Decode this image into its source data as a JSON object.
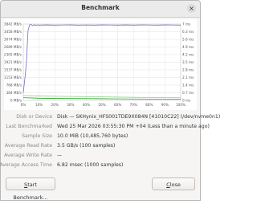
{
  "window": {
    "title": "Benchmark"
  },
  "chart_data": {
    "type": "line",
    "y_left_ticks": [
      "3842 MB/s",
      "3458 MB/s",
      "3074 MB/s",
      "2689 MB/s",
      "2305 MB/s",
      "1921 MB/s",
      "1537 MB/s",
      "1153 MB/s",
      "768 MB/s",
      "384 MB/s",
      "0 MB/s"
    ],
    "y_right_ticks": [
      "7 ms",
      "6.3 ms",
      "5.6 ms",
      "4.9 ms",
      "4.2 ms",
      "3.5 ms",
      "2.8 ms",
      "2.1 ms",
      "1.4 ms",
      "0.7 ms",
      "0 ms"
    ],
    "x_ticks": [
      "0%",
      "10%",
      "20%",
      "30%",
      "40%",
      "50%",
      "60%",
      "70%",
      "80%",
      "90%",
      "100%"
    ],
    "xlim": [
      0,
      100
    ],
    "ylim_left": [
      0,
      3842
    ],
    "ylim_right": [
      0,
      7
    ],
    "grid": true,
    "series": [
      {
        "color": "#7070c8",
        "axis": "left",
        "x": [
          0,
          1,
          2,
          3,
          4,
          5,
          6,
          7,
          8,
          9,
          10,
          15,
          20,
          25,
          30,
          35,
          40,
          45,
          50,
          55,
          60,
          65,
          70,
          75,
          80,
          85,
          90,
          95,
          100
        ],
        "values": [
          384,
          1100,
          1900,
          3500,
          3800,
          3820,
          3760,
          3810,
          3780,
          3800,
          3790,
          3800,
          3790,
          3795,
          3800,
          3790,
          3795,
          3790,
          3800,
          3795,
          3790,
          3800,
          3790,
          3800,
          3795,
          3790,
          3800,
          3795,
          3790
        ]
      },
      {
        "color": "#8ad08a",
        "axis": "right",
        "x": [
          0,
          10,
          20,
          30,
          40,
          50,
          60,
          70,
          80,
          90,
          100
        ],
        "values": [
          0.45,
          0.4,
          0.38,
          0.36,
          0.34,
          0.32,
          0.3,
          0.28,
          0.26,
          0.25,
          0.24
        ]
      },
      {
        "color": "#2aa02a",
        "axis": "right",
        "x": [
          0,
          10,
          20,
          30,
          40,
          50,
          60,
          70,
          80,
          90,
          100
        ],
        "values": [
          0.25,
          0.2,
          0.18,
          0.17,
          0.16,
          0.15,
          0.14,
          0.13,
          0.12,
          0.12,
          0.11
        ]
      }
    ]
  },
  "info": {
    "disk_label": "Disk or Device",
    "disk_value": "Disk — SKHynix_HFS001TDE9X084N [41010C22] (/dev/nvme0n1)",
    "started_label": "Last Benchmarked",
    "started_value": "Wed 25 Mar 2026 03:55:30 PM +04 (Less than a minute ago)",
    "size_label": "Sample Size",
    "size_value": "10.0 MiB (10,485,760 bytes)",
    "read_label": "Average Read Rate",
    "read_value": "3.5 GB/s (100 samples)",
    "write_label": "Average Write Rate",
    "write_value": "—",
    "access_label": "Average Access Time",
    "access_value": "6.82 msec (1000 samples)"
  },
  "buttons": {
    "start_prefix": "S",
    "start_rest": "tart Benchmark...",
    "close_prefix": "C",
    "close_rest": "lose"
  }
}
